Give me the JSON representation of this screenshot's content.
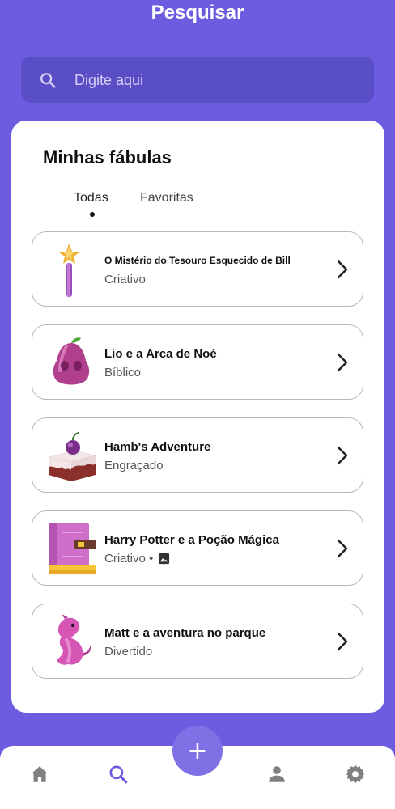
{
  "header": {
    "title": "Pesquisar"
  },
  "search": {
    "placeholder": "Digite aqui"
  },
  "library": {
    "title": "Minhas fábulas",
    "tabs": [
      {
        "label": "Todas",
        "active": true
      },
      {
        "label": "Favoritas",
        "active": false
      }
    ],
    "stories": [
      {
        "title": "O Mistério do Tesouro Esquecido de Bill",
        "genre": "Criativo",
        "icon": "magic-wand-icon"
      },
      {
        "title": "Lio e a Arca de Noé",
        "genre": "Bíblico",
        "icon": "fruit-icon"
      },
      {
        "title": " Hamb's Adventure",
        "genre": "Engraçado",
        "icon": "cake-icon"
      },
      {
        "title": "Harry Potter e a Poção Mágica",
        "genre": "Criativo •",
        "icon": "book-icon",
        "has_image": true
      },
      {
        "title": "Matt e a aventura no parque",
        "genre": "Divertido",
        "icon": "dragon-icon"
      }
    ]
  },
  "nav": {
    "fab_label": "+",
    "items": [
      "home-icon",
      "search-icon",
      "profile-icon",
      "settings-icon"
    ],
    "active": "search-icon"
  },
  "colors": {
    "primary": "#6c5ce0",
    "active_nav": "#6c5ce0",
    "inactive_nav": "#808080"
  }
}
